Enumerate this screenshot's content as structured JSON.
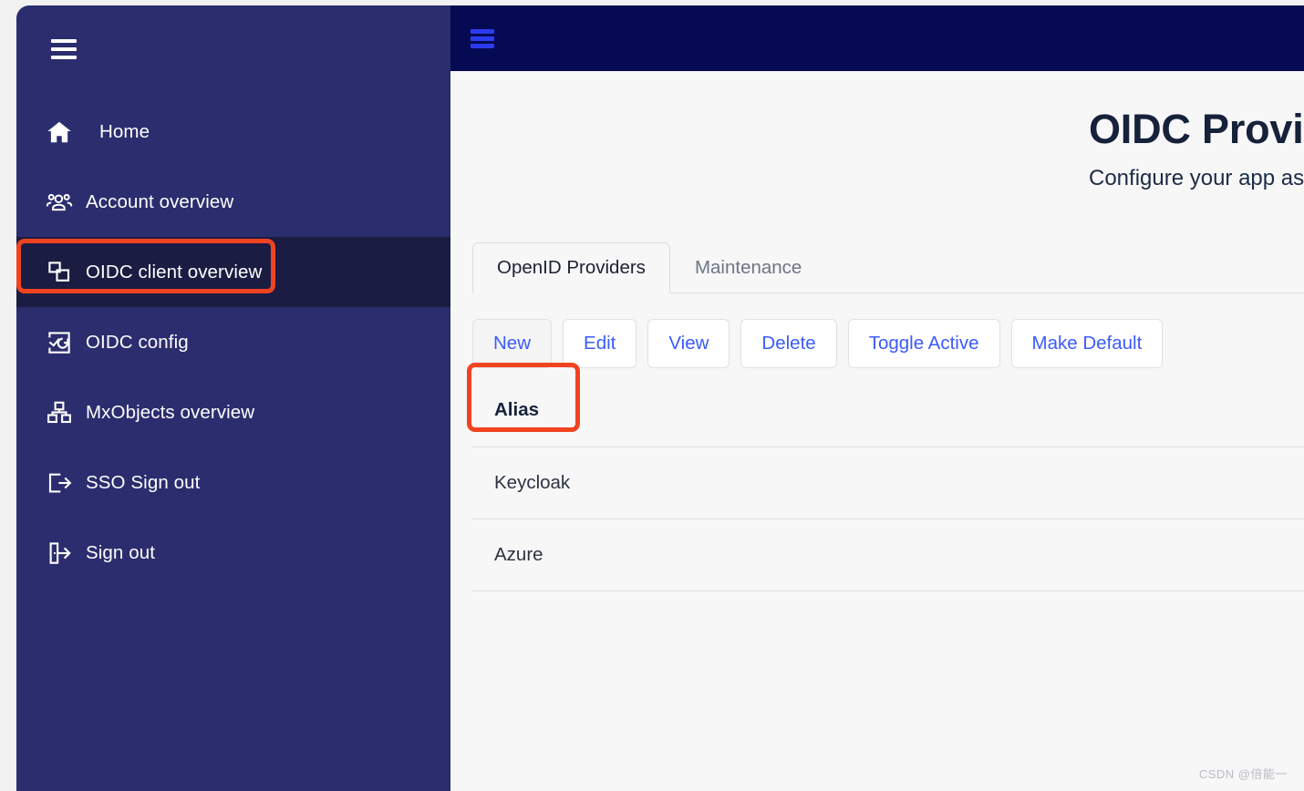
{
  "sidebar": {
    "toggle_icon": "hamburger-icon",
    "items": [
      {
        "label": "Home",
        "icon": "home-icon",
        "active": false
      },
      {
        "label": "Account overview",
        "icon": "people-group-icon",
        "active": false
      },
      {
        "label": "OIDC client overview",
        "icon": "windows-stack-icon",
        "active": true
      },
      {
        "label": "OIDC config",
        "icon": "config-sync-icon",
        "active": false
      },
      {
        "label": "MxObjects overview",
        "icon": "blocks-icon",
        "active": false
      },
      {
        "label": "SSO Sign out",
        "icon": "sign-out-arrow-icon",
        "active": false
      },
      {
        "label": "Sign out",
        "icon": "door-exit-icon",
        "active": false
      }
    ]
  },
  "topbar": {
    "toggle_icon": "hamburger-icon"
  },
  "header": {
    "title": "OIDC Providers",
    "subtitle": "Configure your app as an OIDC client. Create a new OpenID provider."
  },
  "tabs": [
    {
      "label": "OpenID Providers",
      "active": true
    },
    {
      "label": "Maintenance",
      "active": false
    }
  ],
  "toolbar": {
    "buttons": [
      {
        "label": "New",
        "pressed": true
      },
      {
        "label": "Edit",
        "pressed": false
      },
      {
        "label": "View",
        "pressed": false
      },
      {
        "label": "Delete",
        "pressed": false
      },
      {
        "label": "Toggle Active",
        "pressed": false
      },
      {
        "label": "Make Default",
        "pressed": false
      }
    ]
  },
  "table": {
    "columns": [
      "Alias"
    ],
    "rows": [
      {
        "alias": "Keycloak"
      },
      {
        "alias": "Azure"
      }
    ]
  },
  "annotations": {
    "color": "#f04421",
    "targets": [
      "sidebar-item-oidc-client-overview",
      "new-button"
    ]
  },
  "watermark": "CSDN @倍能一",
  "colors": {
    "sidebar_bg": "#2b2d6e",
    "sidebar_active_bg": "#1b1c42",
    "topbar_bg": "#050a52",
    "topbar_icon": "#2a3bf0",
    "content_bg": "#f7f7f8",
    "button_text": "#3b5bfd",
    "annotation": "#f04421"
  }
}
